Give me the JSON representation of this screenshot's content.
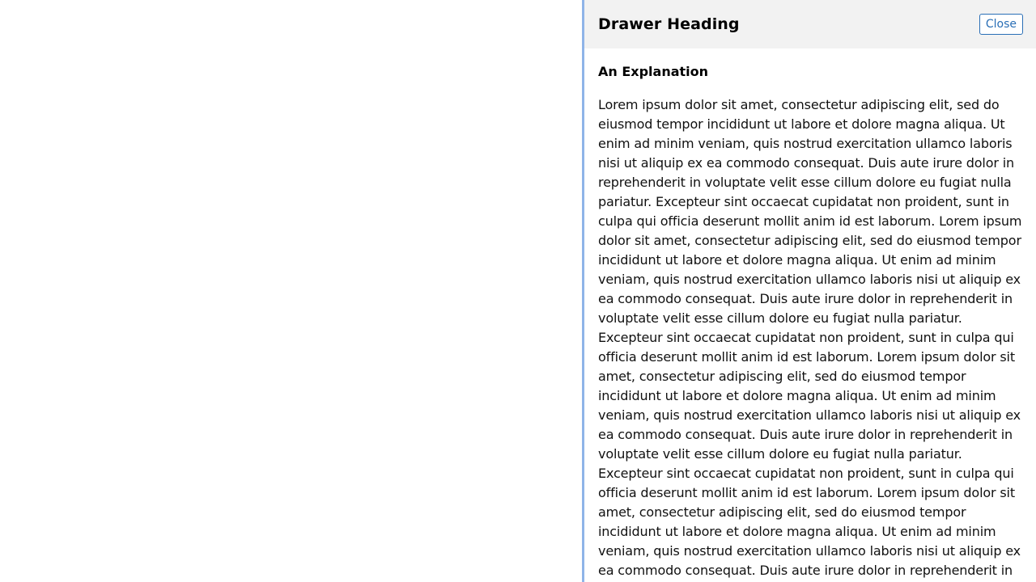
{
  "drawer": {
    "heading": "Drawer Heading",
    "close_label": "Close",
    "section_heading": "An Explanation",
    "paragraph": "Lorem ipsum dolor sit amet, consectetur adipiscing elit, sed do eiusmod tempor incididunt ut labore et dolore magna aliqua. Ut enim ad minim veniam, quis nostrud exercitation ullamco laboris nisi ut aliquip ex ea commodo consequat. Duis aute irure dolor in reprehenderit in voluptate velit esse cillum dolore eu fugiat nulla pariatur. Excepteur sint occaecat cupidatat non proident, sunt in culpa qui officia deserunt mollit anim id est laborum. Lorem ipsum dolor sit amet, consectetur adipiscing elit, sed do eiusmod tempor incididunt ut labore et dolore magna aliqua. Ut enim ad minim veniam, quis nostrud exercitation ullamco laboris nisi ut aliquip ex ea commodo consequat. Duis aute irure dolor in reprehenderit in voluptate velit esse cillum dolore eu fugiat nulla pariatur. Excepteur sint occaecat cupidatat non proident, sunt in culpa qui officia deserunt mollit anim id est laborum. Lorem ipsum dolor sit amet, consectetur adipiscing elit, sed do eiusmod tempor incididunt ut labore et dolore magna aliqua. Ut enim ad minim veniam, quis nostrud exercitation ullamco laboris nisi ut aliquip ex ea commodo consequat. Duis aute irure dolor in reprehenderit in voluptate velit esse cillum dolore eu fugiat nulla pariatur. Excepteur sint occaecat cupidatat non proident, sunt in culpa qui officia deserunt mollit anim id est laborum. Lorem ipsum dolor sit amet, consectetur adipiscing elit, sed do eiusmod tempor incididunt ut labore et dolore magna aliqua. Ut enim ad minim veniam, quis nostrud exercitation ullamco laboris nisi ut aliquip ex ea commodo consequat. Duis aute irure dolor in reprehenderit in voluptate velit esse cillum dolore eu fugiat"
  },
  "colors": {
    "header_background": "#f2f2f2",
    "accent": "#2a6fb6",
    "drawer_border": "#8fb4e8"
  }
}
